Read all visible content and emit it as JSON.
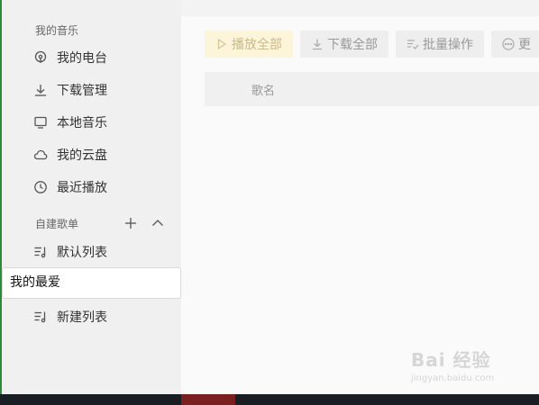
{
  "sidebar": {
    "my_music_title": "我的音乐",
    "my_music_items": [
      {
        "label": "我的电台",
        "icon": "radio-icon"
      },
      {
        "label": "下载管理",
        "icon": "download-icon"
      },
      {
        "label": "本地音乐",
        "icon": "monitor-icon"
      },
      {
        "label": "我的云盘",
        "icon": "cloud-icon"
      },
      {
        "label": "最近播放",
        "icon": "clock-icon"
      }
    ],
    "playlists_title": "自建歌单",
    "add_icon": "plus-icon",
    "collapse_icon": "chevron-up-icon",
    "playlists": [
      {
        "label": "默认列表",
        "icon": "playlist-icon"
      },
      {
        "label": "新建列表",
        "icon": "playlist-icon"
      }
    ],
    "editing_value": "我的最爱"
  },
  "toolbar": {
    "play_all": "播放全部",
    "download_all": "下载全部",
    "batch": "批量操作",
    "more": "更"
  },
  "table": {
    "song_name": "歌名"
  },
  "watermark": {
    "brand": "Bai 经验",
    "url": "jingyan.baidu.com"
  },
  "colors": {
    "accent_green": "#2c8a3a",
    "play_button_bg": "#fdf5d9"
  }
}
